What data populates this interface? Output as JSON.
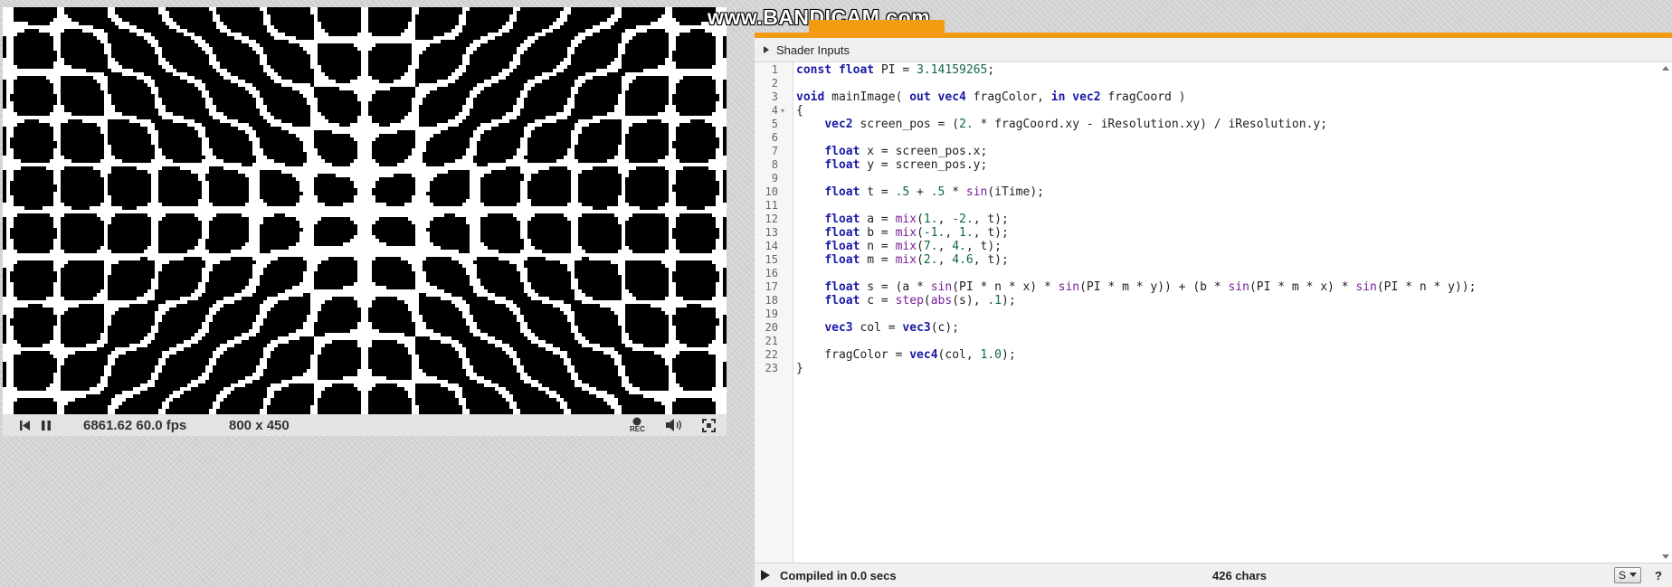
{
  "watermark": "www.BANDICAM.com",
  "player": {
    "time_fps": "6861.62 60.0 fps",
    "resolution": "800 x 450",
    "rec_label": "REC",
    "icons": [
      "rewind-icon",
      "pause-icon",
      "record-icon",
      "volume-icon",
      "fullscreen-icon"
    ]
  },
  "shader_params": {
    "a": -2.0,
    "b": 1.0,
    "n": 4.0,
    "m": 4.6,
    "threshold": 0.1
  },
  "editor": {
    "inputs_label": "Shader Inputs",
    "lines": [
      [
        [
          "kw",
          "const"
        ],
        [
          "pl",
          " "
        ],
        [
          "ty",
          "float"
        ],
        [
          "pl",
          " PI = "
        ],
        [
          "num",
          "3.14159265"
        ],
        [
          "pl",
          ";"
        ]
      ],
      [],
      [
        [
          "ty",
          "void"
        ],
        [
          "pl",
          " mainImage( "
        ],
        [
          "kw",
          "out"
        ],
        [
          "pl",
          " "
        ],
        [
          "ty",
          "vec4"
        ],
        [
          "pl",
          " fragColor, "
        ],
        [
          "kw",
          "in"
        ],
        [
          "pl",
          " "
        ],
        [
          "ty",
          "vec2"
        ],
        [
          "pl",
          " fragCoord )"
        ]
      ],
      [
        [
          "pl",
          "{"
        ]
      ],
      [
        [
          "pl",
          "    "
        ],
        [
          "ty",
          "vec2"
        ],
        [
          "pl",
          " screen_pos = ("
        ],
        [
          "num",
          "2."
        ],
        [
          "pl",
          " * fragCoord.xy - iResolution.xy) / iResolution.y;"
        ]
      ],
      [],
      [
        [
          "pl",
          "    "
        ],
        [
          "ty",
          "float"
        ],
        [
          "pl",
          " x = screen_pos.x;"
        ]
      ],
      [
        [
          "pl",
          "    "
        ],
        [
          "ty",
          "float"
        ],
        [
          "pl",
          " y = screen_pos.y;"
        ]
      ],
      [],
      [
        [
          "pl",
          "    "
        ],
        [
          "ty",
          "float"
        ],
        [
          "pl",
          " t = "
        ],
        [
          "num",
          ".5"
        ],
        [
          "pl",
          " + "
        ],
        [
          "num",
          ".5"
        ],
        [
          "pl",
          " * "
        ],
        [
          "fn",
          "sin"
        ],
        [
          "pl",
          "(iTime);"
        ]
      ],
      [],
      [
        [
          "pl",
          "    "
        ],
        [
          "ty",
          "float"
        ],
        [
          "pl",
          " a = "
        ],
        [
          "fn",
          "mix"
        ],
        [
          "pl",
          "("
        ],
        [
          "num",
          "1."
        ],
        [
          "pl",
          ", "
        ],
        [
          "num",
          "-2."
        ],
        [
          "pl",
          ", t);"
        ]
      ],
      [
        [
          "pl",
          "    "
        ],
        [
          "ty",
          "float"
        ],
        [
          "pl",
          " b = "
        ],
        [
          "fn",
          "mix"
        ],
        [
          "pl",
          "("
        ],
        [
          "num",
          "-1."
        ],
        [
          "pl",
          ", "
        ],
        [
          "num",
          "1."
        ],
        [
          "pl",
          ", t);"
        ]
      ],
      [
        [
          "pl",
          "    "
        ],
        [
          "ty",
          "float"
        ],
        [
          "pl",
          " n = "
        ],
        [
          "fn",
          "mix"
        ],
        [
          "pl",
          "("
        ],
        [
          "num",
          "7."
        ],
        [
          "pl",
          ", "
        ],
        [
          "num",
          "4."
        ],
        [
          "pl",
          ", t);"
        ]
      ],
      [
        [
          "pl",
          "    "
        ],
        [
          "ty",
          "float"
        ],
        [
          "pl",
          " m = "
        ],
        [
          "fn",
          "mix"
        ],
        [
          "pl",
          "("
        ],
        [
          "num",
          "2."
        ],
        [
          "pl",
          ", "
        ],
        [
          "num",
          "4.6"
        ],
        [
          "pl",
          ", t);"
        ]
      ],
      [],
      [
        [
          "pl",
          "    "
        ],
        [
          "ty",
          "float"
        ],
        [
          "pl",
          " s = (a * "
        ],
        [
          "fn",
          "sin"
        ],
        [
          "pl",
          "(PI * n * x) * "
        ],
        [
          "fn",
          "sin"
        ],
        [
          "pl",
          "(PI * m * y)) + (b * "
        ],
        [
          "fn",
          "sin"
        ],
        [
          "pl",
          "(PI * m * x) * "
        ],
        [
          "fn",
          "sin"
        ],
        [
          "pl",
          "(PI * n * y));"
        ]
      ],
      [
        [
          "pl",
          "    "
        ],
        [
          "ty",
          "float"
        ],
        [
          "pl",
          " c = "
        ],
        [
          "fn",
          "step"
        ],
        [
          "pl",
          "("
        ],
        [
          "fn",
          "abs"
        ],
        [
          "pl",
          "(s), "
        ],
        [
          "num",
          ".1"
        ],
        [
          "pl",
          ");"
        ]
      ],
      [],
      [
        [
          "pl",
          "    "
        ],
        [
          "ty",
          "vec3"
        ],
        [
          "pl",
          " col = "
        ],
        [
          "ty",
          "vec3"
        ],
        [
          "pl",
          "(c);"
        ]
      ],
      [],
      [
        [
          "pl",
          "    fragColor = "
        ],
        [
          "ty",
          "vec4"
        ],
        [
          "pl",
          "(col, "
        ],
        [
          "num",
          "1.0"
        ],
        [
          "pl",
          ");"
        ]
      ],
      [
        [
          "pl",
          "}"
        ]
      ]
    ]
  },
  "status": {
    "compiled": "Compiled in 0.0 secs",
    "chars": "426 chars",
    "select_value": "S",
    "help": "?"
  }
}
